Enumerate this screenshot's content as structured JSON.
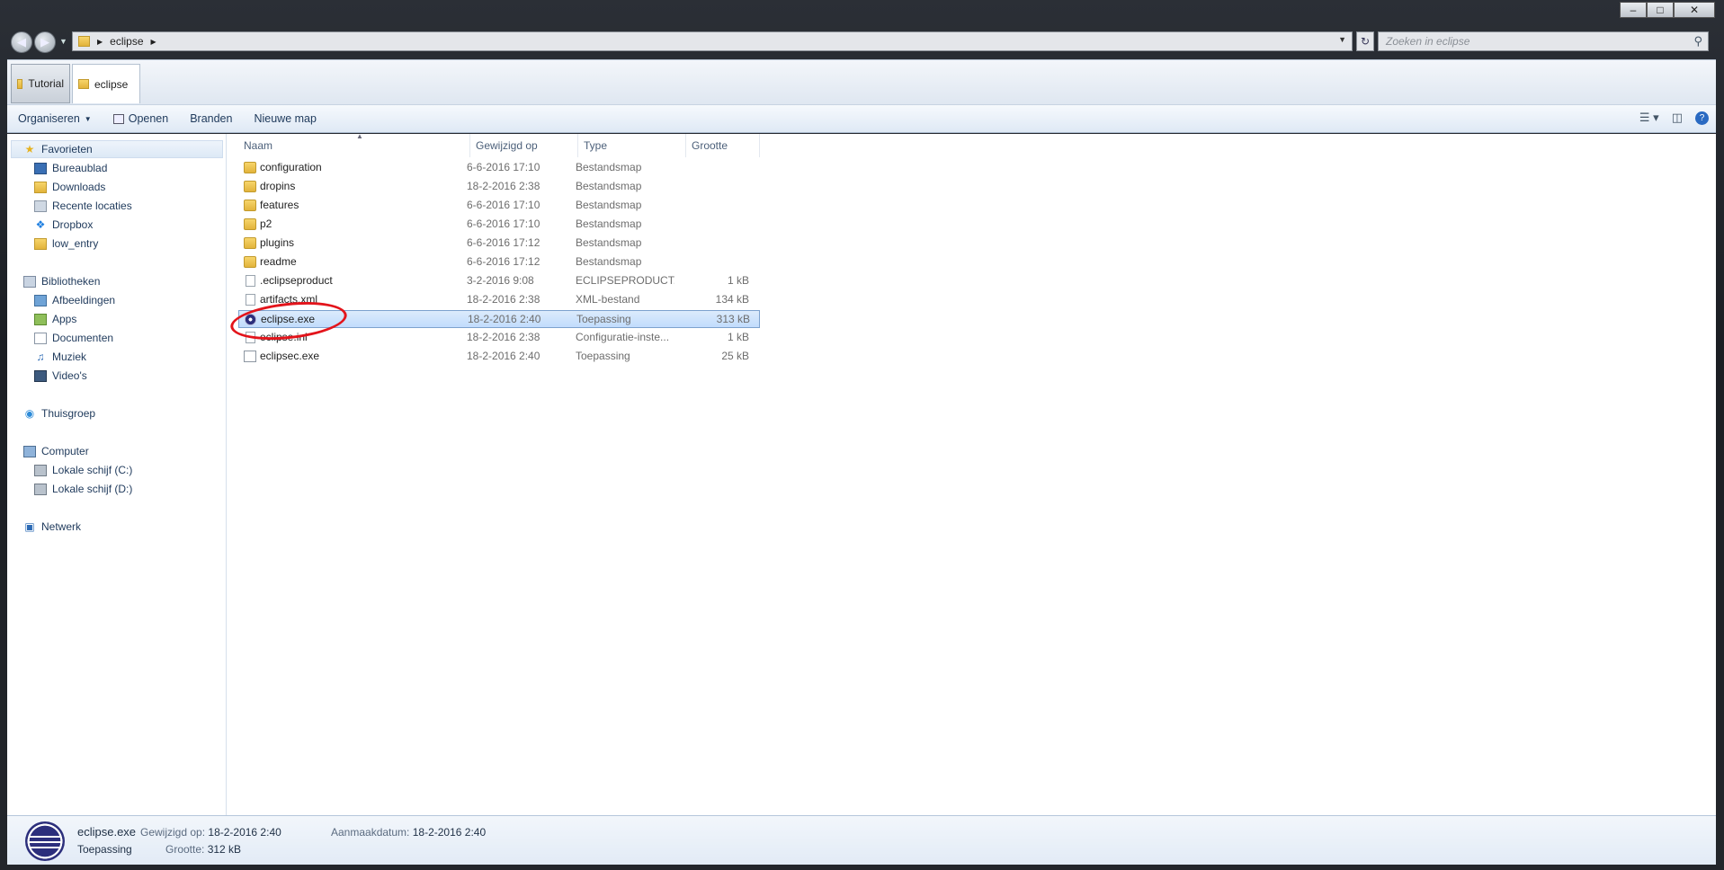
{
  "window": {
    "minimize_label": "–",
    "maximize_label": "□",
    "close_label": "✕"
  },
  "address": {
    "segments": [
      "eclipse"
    ],
    "search_placeholder": "Zoeken in eclipse"
  },
  "tabs": [
    {
      "label": "Tutorial"
    },
    {
      "label": "eclipse"
    }
  ],
  "toolbar": {
    "organize_label": "Organiseren",
    "open_label": "Openen",
    "burn_label": "Branden",
    "new_folder_label": "Nieuwe map"
  },
  "sidebar": {
    "favorites": {
      "label": "Favorieten",
      "items": [
        {
          "label": "Bureaublad",
          "icon": "desktop-icon"
        },
        {
          "label": "Downloads",
          "icon": "downloads-folder-icon"
        },
        {
          "label": "Recente locaties",
          "icon": "recent-places-icon"
        },
        {
          "label": "Dropbox",
          "icon": "dropbox-icon"
        },
        {
          "label": "low_entry",
          "icon": "folder-icon"
        }
      ]
    },
    "libraries": {
      "label": "Bibliotheken",
      "items": [
        {
          "label": "Afbeeldingen",
          "icon": "pictures-icon"
        },
        {
          "label": "Apps",
          "icon": "apps-icon"
        },
        {
          "label": "Documenten",
          "icon": "documents-icon"
        },
        {
          "label": "Muziek",
          "icon": "music-icon"
        },
        {
          "label": "Video's",
          "icon": "videos-icon"
        }
      ]
    },
    "homegroup": {
      "label": "Thuisgroep"
    },
    "computer": {
      "label": "Computer",
      "items": [
        {
          "label": "Lokale schijf (C:)",
          "icon": "drive-c-icon"
        },
        {
          "label": "Lokale schijf (D:)",
          "icon": "drive-d-icon"
        }
      ]
    },
    "network": {
      "label": "Netwerk"
    }
  },
  "columns": {
    "name": "Naam",
    "modified": "Gewijzigd op",
    "type": "Type",
    "size": "Grootte"
  },
  "files": [
    {
      "name": "configuration",
      "modified": "6-6-2016 17:10",
      "type": "Bestandsmap",
      "size": "",
      "kind": "folder"
    },
    {
      "name": "dropins",
      "modified": "18-2-2016 2:38",
      "type": "Bestandsmap",
      "size": "",
      "kind": "folder"
    },
    {
      "name": "features",
      "modified": "6-6-2016 17:10",
      "type": "Bestandsmap",
      "size": "",
      "kind": "folder"
    },
    {
      "name": "p2",
      "modified": "6-6-2016 17:10",
      "type": "Bestandsmap",
      "size": "",
      "kind": "folder"
    },
    {
      "name": "plugins",
      "modified": "6-6-2016 17:12",
      "type": "Bestandsmap",
      "size": "",
      "kind": "folder"
    },
    {
      "name": "readme",
      "modified": "6-6-2016 17:12",
      "type": "Bestandsmap",
      "size": "",
      "kind": "folder"
    },
    {
      "name": ".eclipseproduct",
      "modified": "3-2-2016 9:08",
      "type": "ECLIPSEPRODUCT...",
      "size": "1 kB",
      "kind": "doc"
    },
    {
      "name": "artifacts.xml",
      "modified": "18-2-2016 2:38",
      "type": "XML-bestand",
      "size": "134 kB",
      "kind": "doc"
    },
    {
      "name": "eclipse.exe",
      "modified": "18-2-2016 2:40",
      "type": "Toepassing",
      "size": "313 kB",
      "kind": "exe"
    },
    {
      "name": "eclipse.ini",
      "modified": "18-2-2016 2:38",
      "type": "Configuratie-inste...",
      "size": "1 kB",
      "kind": "doc"
    },
    {
      "name": "eclipsec.exe",
      "modified": "18-2-2016 2:40",
      "type": "Toepassing",
      "size": "25 kB",
      "kind": "exec"
    }
  ],
  "details": {
    "filename": "eclipse.exe",
    "modified_label": "Gewijzigd op:",
    "modified_value": "18-2-2016 2:40",
    "created_label": "Aanmaakdatum:",
    "created_value": "18-2-2016 2:40",
    "type": "Toepassing",
    "size_label": "Grootte:",
    "size_value": "312 kB"
  }
}
